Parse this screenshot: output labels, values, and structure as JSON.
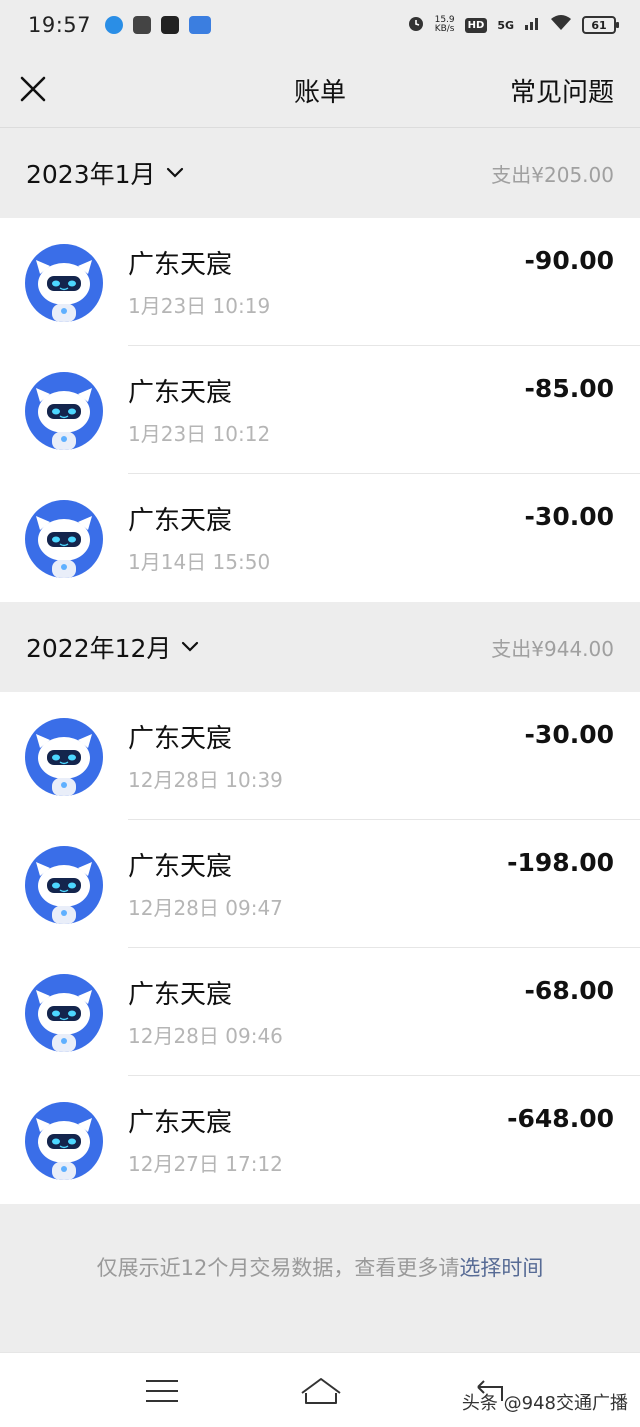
{
  "status_bar": {
    "time": "19:57",
    "net_speed_value": "15.9",
    "net_speed_unit": "KB/s",
    "hd": "HD",
    "network": "5G",
    "battery": "61"
  },
  "nav": {
    "title": "账单",
    "faq": "常见问题"
  },
  "groups": [
    {
      "month": "2023年1月",
      "expense": "支出¥205.00",
      "items": [
        {
          "name": "广东天宸",
          "time": "1月23日 10:19",
          "amount": "-90.00"
        },
        {
          "name": "广东天宸",
          "time": "1月23日 10:12",
          "amount": "-85.00"
        },
        {
          "name": "广东天宸",
          "time": "1月14日 15:50",
          "amount": "-30.00"
        }
      ]
    },
    {
      "month": "2022年12月",
      "expense": "支出¥944.00",
      "items": [
        {
          "name": "广东天宸",
          "time": "12月28日 10:39",
          "amount": "-30.00"
        },
        {
          "name": "广东天宸",
          "time": "12月28日 09:47",
          "amount": "-198.00"
        },
        {
          "name": "广东天宸",
          "time": "12月28日 09:46",
          "amount": "-68.00"
        },
        {
          "name": "广东天宸",
          "time": "12月27日 17:12",
          "amount": "-648.00"
        }
      ]
    }
  ],
  "footer": {
    "note": "仅展示近12个月交易数据，查看更多请",
    "link": "选择时间"
  },
  "watermark": "头条 @948交通广播",
  "colors": {
    "background": "#ededed",
    "card": "#ffffff",
    "avatar_blue": "#3a6ee8",
    "link": "#576b95",
    "muted": "#a0a0a0"
  },
  "icons": {
    "close": "close-icon",
    "month_expand": "chevron-down-icon",
    "avatar": "robot-avatar-icon",
    "sys_menu": "menu-icon",
    "sys_home": "home-icon",
    "sys_back": "back-icon"
  }
}
